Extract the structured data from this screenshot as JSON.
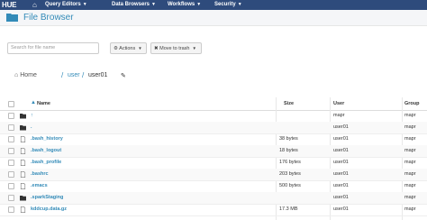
{
  "nav": {
    "logo": "HUE",
    "items": [
      {
        "label": "Query Editors"
      },
      {
        "label": "Data Browsers"
      },
      {
        "label": "Workflows"
      },
      {
        "label": "Security"
      }
    ]
  },
  "page": {
    "title": "File Browser"
  },
  "toolbar": {
    "search_placeholder": "Search for file name",
    "actions_label": "Actions",
    "trash_label": "Move to trash"
  },
  "breadcrumb": {
    "home": "Home",
    "sep": "/",
    "user": "user",
    "current": "user01"
  },
  "table": {
    "headers": {
      "name": "Name",
      "size": "Size",
      "user": "User",
      "group": "Group"
    },
    "rows": [
      {
        "type": "folder",
        "name": "↑",
        "size": "",
        "user": "mapr",
        "group": "mapr"
      },
      {
        "type": "folder",
        "name": ".",
        "size": "",
        "user": "user01",
        "group": "mapr"
      },
      {
        "type": "file",
        "name": ".bash_history",
        "size": "38 bytes",
        "user": "user01",
        "group": "mapr"
      },
      {
        "type": "file",
        "name": ".bash_logout",
        "size": "18 bytes",
        "user": "user01",
        "group": "mapr"
      },
      {
        "type": "file",
        "name": ".bash_profile",
        "size": "176 bytes",
        "user": "user01",
        "group": "mapr"
      },
      {
        "type": "file",
        "name": ".bashrc",
        "size": "203 bytes",
        "user": "user01",
        "group": "mapr"
      },
      {
        "type": "file",
        "name": ".emacs",
        "size": "500 bytes",
        "user": "user01",
        "group": "mapr"
      },
      {
        "type": "folder",
        "name": ".sparkStaging",
        "size": "",
        "user": "user01",
        "group": "mapr"
      },
      {
        "type": "file",
        "name": "kddcup.data.gz",
        "size": "17.3 MB",
        "user": "user01",
        "group": "mapr"
      }
    ]
  },
  "colors": {
    "nav_bg": "#2e4b7c",
    "link": "#338bb8"
  }
}
